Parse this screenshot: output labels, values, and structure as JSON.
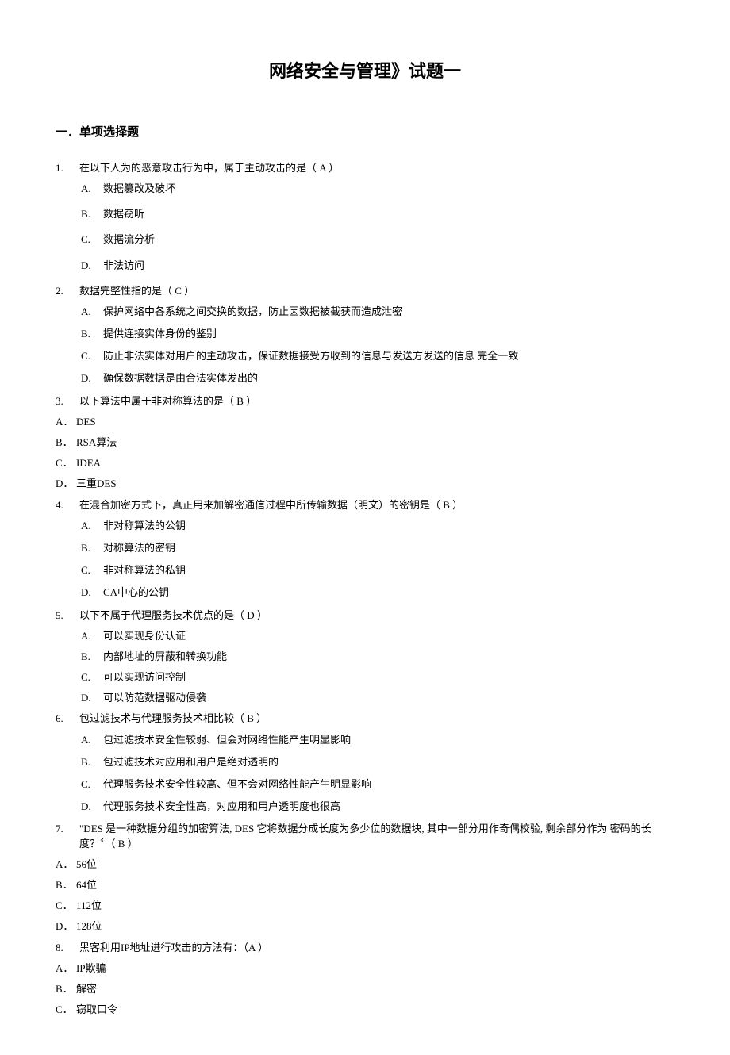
{
  "title": "网络安全与管理》试题一",
  "section": "一．单项选择题",
  "questions": [
    {
      "num": "1.",
      "text": "在以下人为的恶意攻击行为中，属于主动攻击的是（ A ）",
      "options": [
        {
          "label": "A.",
          "text": "数据篡改及破坏"
        },
        {
          "label": "B.",
          "text": "数据窃听"
        },
        {
          "label": "C.",
          "text": "数据流分析"
        },
        {
          "label": "D.",
          "text": "非法访问"
        }
      ]
    },
    {
      "num": "2.",
      "text": "数据完整性指的是（ C ）",
      "options": [
        {
          "label": "A.",
          "text": "保护网络中各系统之间交换的数据，防止因数据被截获而造成泄密"
        },
        {
          "label": "B.",
          "text": "提供连接实体身份的鉴别"
        },
        {
          "label": "C.",
          "text": "防止非法实体对用户的主动攻击，保证数据接受方收到的信息与发送方发送的信息 完全一致"
        },
        {
          "label": "D.",
          "text": "确保数据数据是由合法实体发出的"
        }
      ]
    },
    {
      "num": "3.",
      "text": "以下算法中属于非对称算法的是（ B ）",
      "flatOptions": [
        {
          "label": "A．",
          "text": "DES"
        },
        {
          "label": "B．",
          "text": "RSA算法"
        },
        {
          "label": "C．",
          "text": "IDEA"
        },
        {
          "label": "D．",
          "text": "三重DES"
        }
      ]
    },
    {
      "num": "4.",
      "text": "在混合加密方式下，真正用来加解密通信过程中所传输数据（明文）的密钥是（ B ）",
      "options": [
        {
          "label": "A.",
          "text": "非对称算法的公钥"
        },
        {
          "label": "B.",
          "text": "对称算法的密钥"
        },
        {
          "label": "C.",
          "text": "非对称算法的私钥"
        },
        {
          "label": "D.",
          "text": "CA中心的公钥"
        }
      ]
    },
    {
      "num": "5.",
      "text": "以下不属于代理服务技术优点的是（ D ）",
      "options": [
        {
          "label": "A.",
          "text": "可以实现身份认证"
        },
        {
          "label": "B.",
          "text": "内部地址的屏蔽和转换功能"
        },
        {
          "label": "C.",
          "text": "可以实现访问控制"
        },
        {
          "label": "D.",
          "text": "可以防范数据驱动侵袭"
        }
      ]
    },
    {
      "num": "6.",
      "text": "包过滤技术与代理服务技术相比较（ B ）",
      "options": [
        {
          "label": "A.",
          "text": "包过滤技术安全性较弱、但会对网络性能产生明显影响"
        },
        {
          "label": "B.",
          "text": "包过滤技术对应用和用户是绝对透明的"
        },
        {
          "label": "C.",
          "text": "代理服务技术安全性较高、但不会对网络性能产生明显影响"
        },
        {
          "label": "D.",
          "text": "代理服务技术安全性高，对应用和用户透明度也很高"
        }
      ]
    },
    {
      "num": "7.",
      "text": "\"DES 是一种数据分组的加密算法,  DES 它将数据分成长度为多少位的数据块, 其中一部分用作奇偶校验, 剩余部分作为  密码的长度？〞（ B ）",
      "flatOptions": [
        {
          "label": "A．",
          "text": "56位"
        },
        {
          "label": "B．",
          "text": "64位"
        },
        {
          "label": "C．",
          "text": "112位"
        },
        {
          "label": "D．",
          "text": "128位"
        }
      ]
    },
    {
      "num": "8.",
      "text": " 黑客利用IP地址进行攻击的方法有：（A ）",
      "flatOptions": [
        {
          "label": "A．",
          "text": "IP欺骗"
        },
        {
          "label": "B．",
          "text": "解密"
        },
        {
          "label": "C．",
          "text": "窃取口令"
        }
      ]
    }
  ]
}
